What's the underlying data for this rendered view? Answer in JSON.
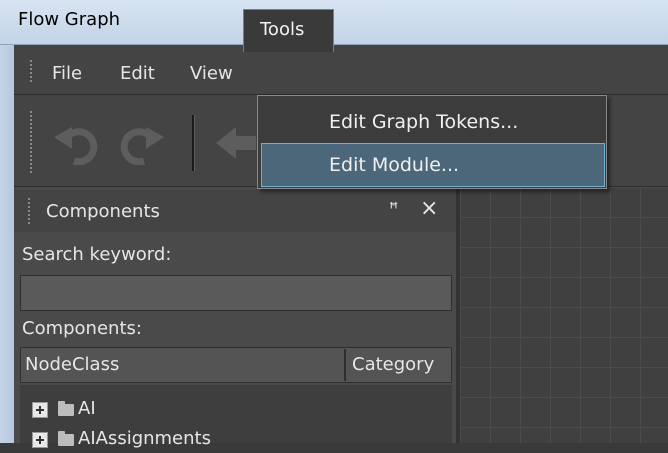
{
  "window": {
    "title": "Flow Graph"
  },
  "menubar": {
    "items": [
      "File",
      "Edit",
      "View",
      "Tools"
    ]
  },
  "tools_menu": {
    "items": [
      "Edit Graph Tokens...",
      "Edit Module..."
    ],
    "highlighted_index": 1
  },
  "toolbar": {
    "icons": [
      "undo-icon",
      "redo-icon",
      "back-arrow-icon"
    ]
  },
  "components_panel": {
    "title": "Components",
    "pin_glyph": "ꟸ",
    "close_glyph": "×",
    "search_label": "Search keyword:",
    "search_value": "",
    "list_label": "Components:",
    "columns": [
      "NodeClass",
      "Category"
    ],
    "tree_items": [
      "AI",
      "AIAssignments"
    ]
  },
  "colors": {
    "highlight": "#4b6779",
    "highlight_border": "#74aed0"
  }
}
